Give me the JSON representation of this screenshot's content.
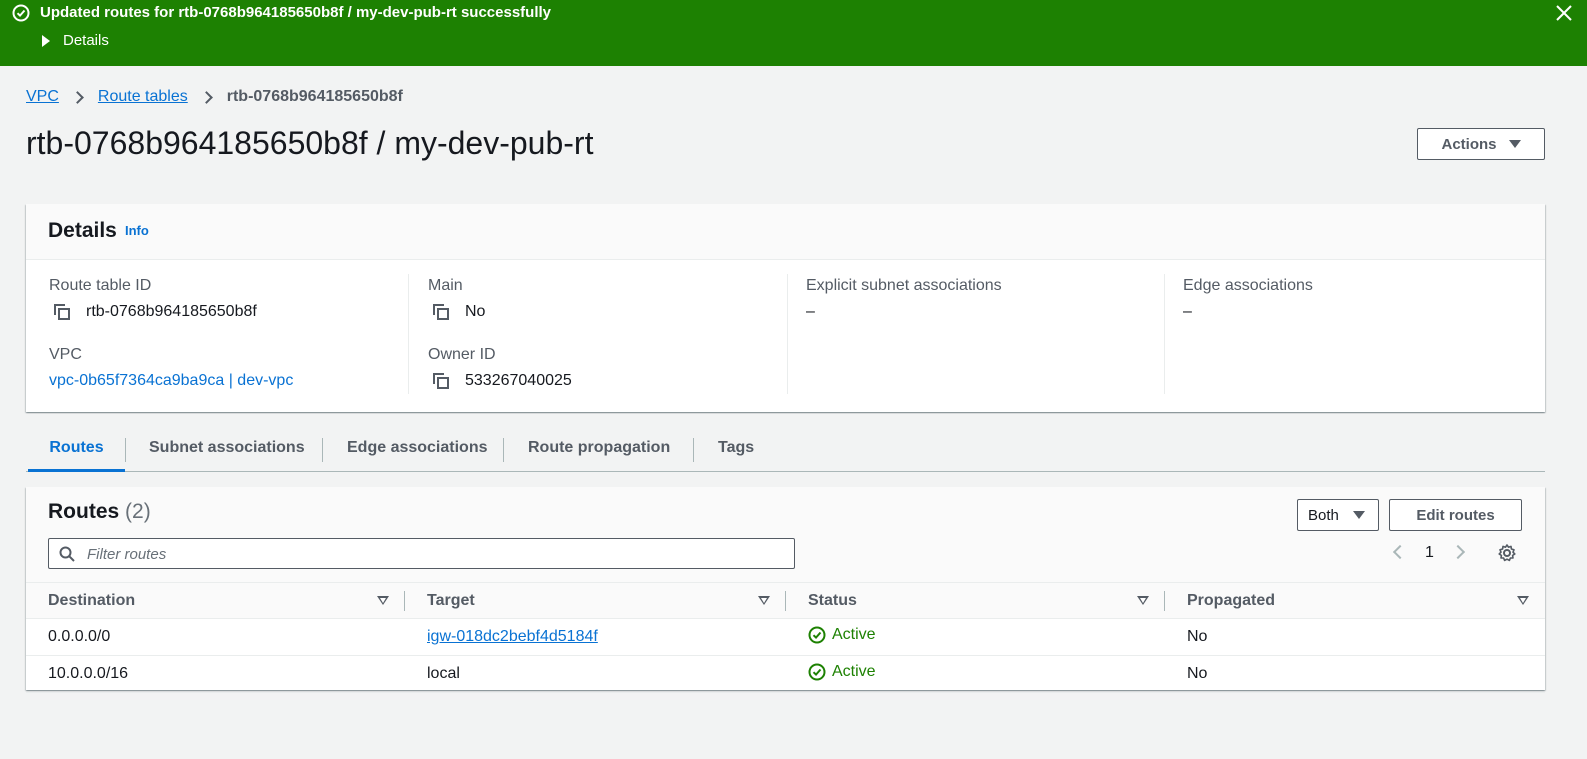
{
  "flash": {
    "message": "Updated routes for rtb-0768b964185650b8f / my-dev-pub-rt successfully",
    "details_label": "Details",
    "color": "#1d8102"
  },
  "breadcrumb": {
    "items": [
      "VPC",
      "Route tables"
    ],
    "current": "rtb-0768b964185650b8f"
  },
  "page": {
    "title": "rtb-0768b964185650b8f / my-dev-pub-rt",
    "actions_label": "Actions"
  },
  "details": {
    "heading": "Details",
    "info_label": "Info",
    "route_table_id_label": "Route table ID",
    "route_table_id": "rtb-0768b964185650b8f",
    "vpc_label": "VPC",
    "vpc_value": "vpc-0b65f7364ca9ba9ca | dev-vpc",
    "main_label": "Main",
    "main_value": "No",
    "owner_label": "Owner ID",
    "owner_value": "533267040025",
    "explicit_label": "Explicit subnet associations",
    "explicit_value": "–",
    "edge_label": "Edge associations",
    "edge_value": "–"
  },
  "tabs": [
    "Routes",
    "Subnet associations",
    "Edge associations",
    "Route propagation",
    "Tags"
  ],
  "routes": {
    "title": "Routes",
    "count": "(2)",
    "filter_select": "Both",
    "edit_label": "Edit routes",
    "filter_placeholder": "Filter routes",
    "page_number": "1",
    "columns": [
      "Destination",
      "Target",
      "Status",
      "Propagated"
    ],
    "rows": [
      {
        "destination": "0.0.0.0/0",
        "target": "igw-018dc2bebf4d5184f",
        "status": "Active",
        "propagated": "No"
      },
      {
        "destination": "10.0.0.0/16",
        "target": "local",
        "status": "Active",
        "propagated": "No"
      }
    ]
  },
  "colors": {
    "link": "#0972d3",
    "success": "#1d8102",
    "text": "#16191f"
  }
}
